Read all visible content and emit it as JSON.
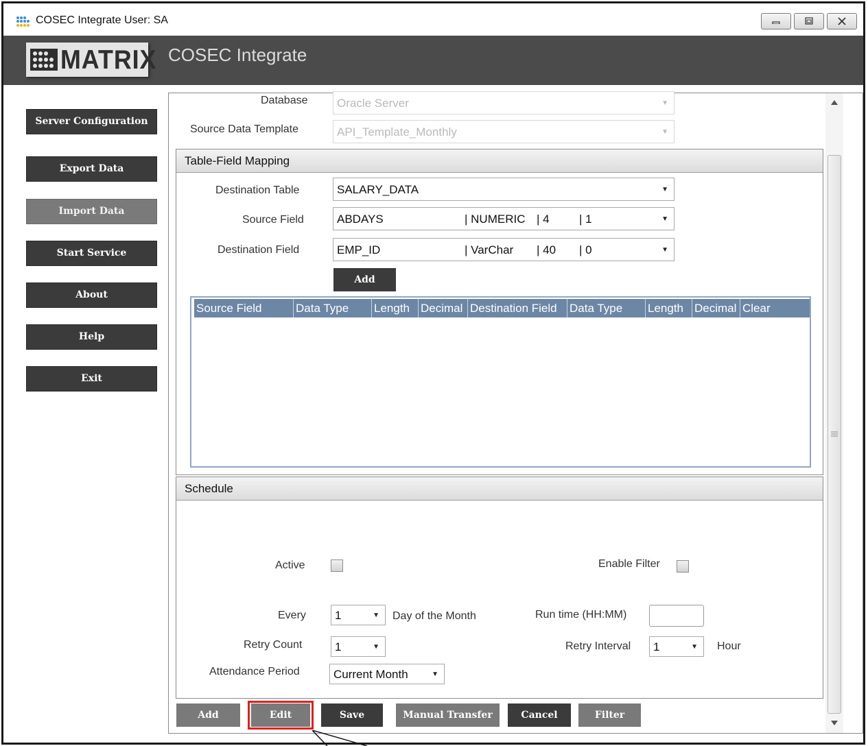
{
  "window": {
    "title": "COSEC Integrate  User: SA"
  },
  "header": {
    "logo_text": "MATRIX",
    "app_title": "COSEC Integrate"
  },
  "sidebar": {
    "items": [
      {
        "label": "Server Configuration"
      },
      {
        "label": "Export Data"
      },
      {
        "label": "Import Data"
      },
      {
        "label": "Start Service"
      },
      {
        "label": "About"
      },
      {
        "label": "Help"
      },
      {
        "label": "Exit"
      }
    ]
  },
  "form": {
    "database_label": "Database",
    "database_value": "Oracle Server",
    "template_label": "Source Data Template",
    "template_value": "API_Template_Monthly"
  },
  "mapping": {
    "title": "Table-Field Mapping",
    "dest_table_label": "Destination Table",
    "dest_table_value": "SALARY_DATA",
    "source_field_label": "Source Field",
    "source_field": {
      "name": "ABDAYS",
      "type": "| NUMERIC",
      "length": "| 4",
      "decimal": "| 1"
    },
    "dest_field_label": "Destination Field",
    "dest_field": {
      "name": "EMP_ID",
      "type": "| VarChar",
      "length": "| 40",
      "decimal": "| 0"
    },
    "add_label": "Add",
    "columns": [
      "Source Field",
      "Data Type",
      "Length",
      "Decimal",
      "Destination Field",
      "Data Type",
      "Length",
      "Decimal",
      "Clear"
    ]
  },
  "schedule": {
    "title": "Schedule",
    "active_label": "Active",
    "enable_filter_label": "Enable Filter",
    "every_label": "Every",
    "every_value": "1",
    "day_label": "Day of the Month",
    "runtime_label": "Run time (HH:MM)",
    "runtime_value": "",
    "retry_count_label": "Retry Count",
    "retry_count_value": "1",
    "retry_interval_label": "Retry Interval",
    "retry_interval_value": "1",
    "hour_label": "Hour",
    "attendance_label": "Attendance Period",
    "attendance_value": "Current Month"
  },
  "actions": {
    "add": "Add",
    "edit": "Edit",
    "save": "Save",
    "manual_transfer": "Manual Transfer",
    "cancel": "Cancel",
    "filter": "Filter"
  },
  "colors": {
    "header_bg": "#4b4b4b",
    "button_dark": "#3b3b3b",
    "button_disabled": "#7a7a7a",
    "grid_header": "#6c86a5",
    "highlight": "#e0201c"
  }
}
